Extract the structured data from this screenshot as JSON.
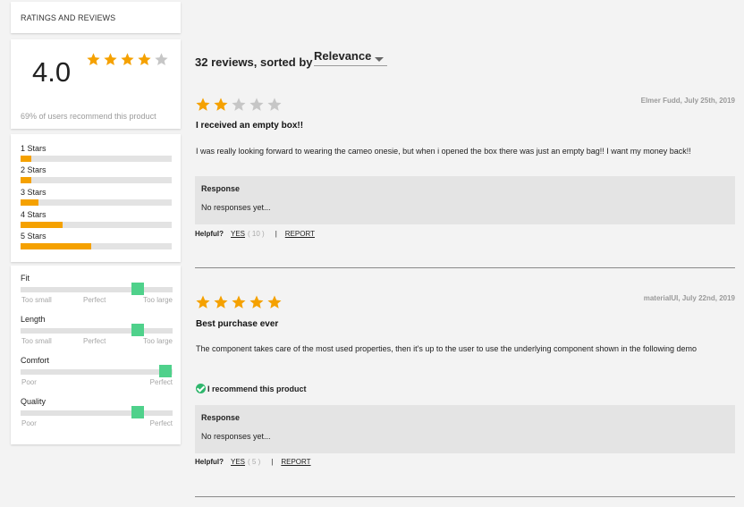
{
  "header": {
    "title": "RATINGS AND REVIEWS"
  },
  "summary": {
    "average": "4.0",
    "average_stars": 4,
    "recommend_text": "69% of users recommend this product"
  },
  "distribution": [
    {
      "label": "1 Stars",
      "fraction": 0.07
    },
    {
      "label": "2 Stars",
      "fraction": 0.07
    },
    {
      "label": "3 Stars",
      "fraction": 0.12
    },
    {
      "label": "4 Stars",
      "fraction": 0.28
    },
    {
      "label": "5 Stars",
      "fraction": 0.47
    }
  ],
  "characteristics": [
    {
      "label": "Fit",
      "level": 0.77,
      "ticks": [
        "Too small",
        "Perfect",
        "Too large"
      ]
    },
    {
      "label": "Length",
      "level": 0.77,
      "ticks": [
        "Too small",
        "Perfect",
        "Too large"
      ]
    },
    {
      "label": "Comfort",
      "level": 0.95,
      "ticks": [
        "Poor",
        "Perfect"
      ]
    },
    {
      "label": "Quality",
      "level": 0.77,
      "ticks": [
        "Poor",
        "Perfect"
      ]
    }
  ],
  "list_header": {
    "summary": "32 reviews, sorted by",
    "sort_value": "Relevance"
  },
  "reviews": [
    {
      "rating": 2,
      "meta": "Elmer Fudd, July 25th, 2019",
      "title": "I received an empty box!!",
      "body": "I was really looking forward to wearing the cameo onesie, but when i opened the box there was just an empty bag!! I want my money back!!",
      "recommend": "",
      "response_heading": "Response",
      "response_text": "No responses yet...",
      "helpful_label": "Helpful?",
      "yes_label": "YES",
      "yes_count": "( 10 )",
      "separator": "|",
      "report_label": "REPORT"
    },
    {
      "rating": 5,
      "meta": "materialUI, July 22nd, 2019",
      "title": "Best purchase ever",
      "body": "The component takes care of the most used properties, then it's up to the user to use the underlying component shown in the following demo",
      "recommend": "I recommend this product",
      "response_heading": "Response",
      "response_text": "No responses yet...",
      "helpful_label": "Helpful?",
      "yes_label": "YES",
      "yes_count": "( 5 )",
      "separator": "|",
      "report_label": "REPORT"
    }
  ],
  "colors": {
    "star_filled": "#f5a100",
    "star_empty": "#c6c6c6",
    "bar_fill": "#f5a100",
    "slider_thumb": "#4fd18b",
    "check": "#2fb66c"
  },
  "icons": {
    "star": "star-icon",
    "check": "check-circle-icon",
    "dropdown": "chevron-down-icon"
  }
}
